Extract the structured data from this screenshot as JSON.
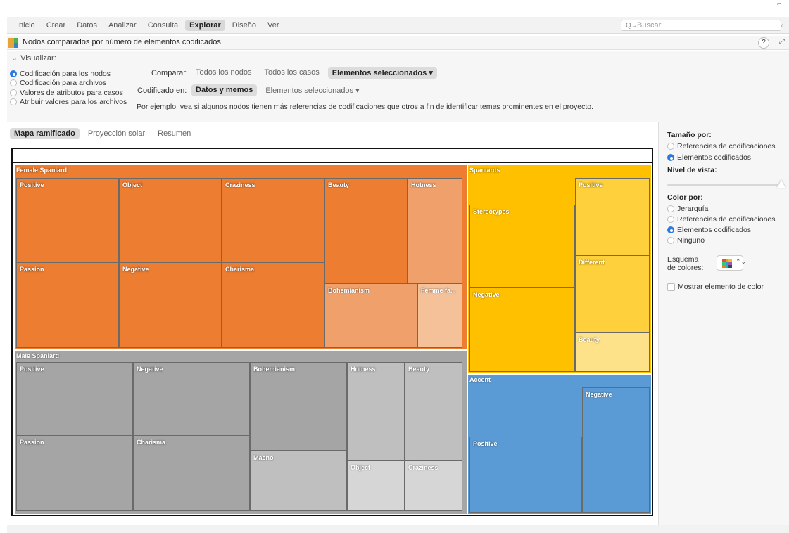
{
  "menu": {
    "items": [
      "Inicio",
      "Crear",
      "Datos",
      "Analizar",
      "Consulta",
      "Explorar",
      "Diseño",
      "Ver"
    ],
    "active_index": 5,
    "search_placeholder": "Buscar"
  },
  "title": "Nodos comparados por número de elementos codificados",
  "help_label": "?",
  "visualize": {
    "header": "Visualizar:",
    "options": [
      {
        "label": "Codificación para los nodos",
        "selected": true
      },
      {
        "label": "Codificación para archivos",
        "selected": false
      },
      {
        "label": "Valores de atributos para casos",
        "selected": false
      },
      {
        "label": "Atribuir valores para los archivos",
        "selected": false
      }
    ],
    "compare_label": "Comparar:",
    "compare_options": [
      {
        "label": "Todos los nodos",
        "selected": false
      },
      {
        "label": "Todos los casos",
        "selected": false
      },
      {
        "label": "Elementos seleccionados ▾",
        "selected": true
      }
    ],
    "coded_label": "Codificado en:",
    "coded_options": [
      {
        "label": "Datos y memos",
        "selected": true
      },
      {
        "label": "Elementos seleccionados ▾",
        "selected": false
      }
    ],
    "example": "Por ejemplo, vea si algunos nodos tienen más referencias de codificaciones que otros a fin de identificar temas prominentes en el proyecto."
  },
  "view_tabs": [
    {
      "label": "Mapa ramificado",
      "selected": true
    },
    {
      "label": "Proyección solar",
      "selected": false
    },
    {
      "label": "Resumen",
      "selected": false
    }
  ],
  "colors": {
    "orange": "#ed7d31",
    "orange_light": "#f0a06a",
    "orange_lighter": "#f5c199",
    "gray": "#a5a5a5",
    "gray_light": "#bfbfbf",
    "gray_lighter": "#d6d6d6",
    "yellow": "#ffc000",
    "yellow_mid": "#fdd03c",
    "yellow_light": "#fde28a",
    "blue": "#5b9bd5",
    "accent_blue": "#2b7ae4"
  },
  "treemap": {
    "groups": [
      {
        "name": "Female Spaniard",
        "cells": [
          "Positive",
          "Object",
          "Craziness",
          "Beauty",
          "Hotness",
          "Passion",
          "Negative",
          "Charisma",
          "Bohemianism",
          "Femme fa..."
        ]
      },
      {
        "name": "Male Spaniard",
        "cells": [
          "Positive",
          "Negative",
          "Bohemianism",
          "Hotness",
          "Beauty",
          "Passion",
          "Charisma",
          "Macho",
          "Object",
          "Craziness"
        ]
      },
      {
        "name": "Spaniards",
        "cells": [
          "Positive",
          "Stereotypes",
          "Different",
          "Negative",
          "Beauty"
        ]
      },
      {
        "name": "Accent",
        "cells": [
          "Negative",
          "Positive"
        ]
      }
    ]
  },
  "sidebar": {
    "size_header": "Tamaño por:",
    "size_options": [
      {
        "label": "Referencias de codificaciones",
        "selected": false
      },
      {
        "label": "Elementos codificados",
        "selected": true
      }
    ],
    "level_header": "Nivel de vista:",
    "color_header": "Color por:",
    "color_options": [
      {
        "label": "Jerarquía",
        "selected": false
      },
      {
        "label": "Referencias de codificaciones",
        "selected": false
      },
      {
        "label": "Elementos codificados",
        "selected": true
      },
      {
        "label": "Ninguno",
        "selected": false
      }
    ],
    "scheme_label_1": "Esquema",
    "scheme_label_2": "de colores:",
    "show_color_label": "Mostrar elemento de color"
  }
}
